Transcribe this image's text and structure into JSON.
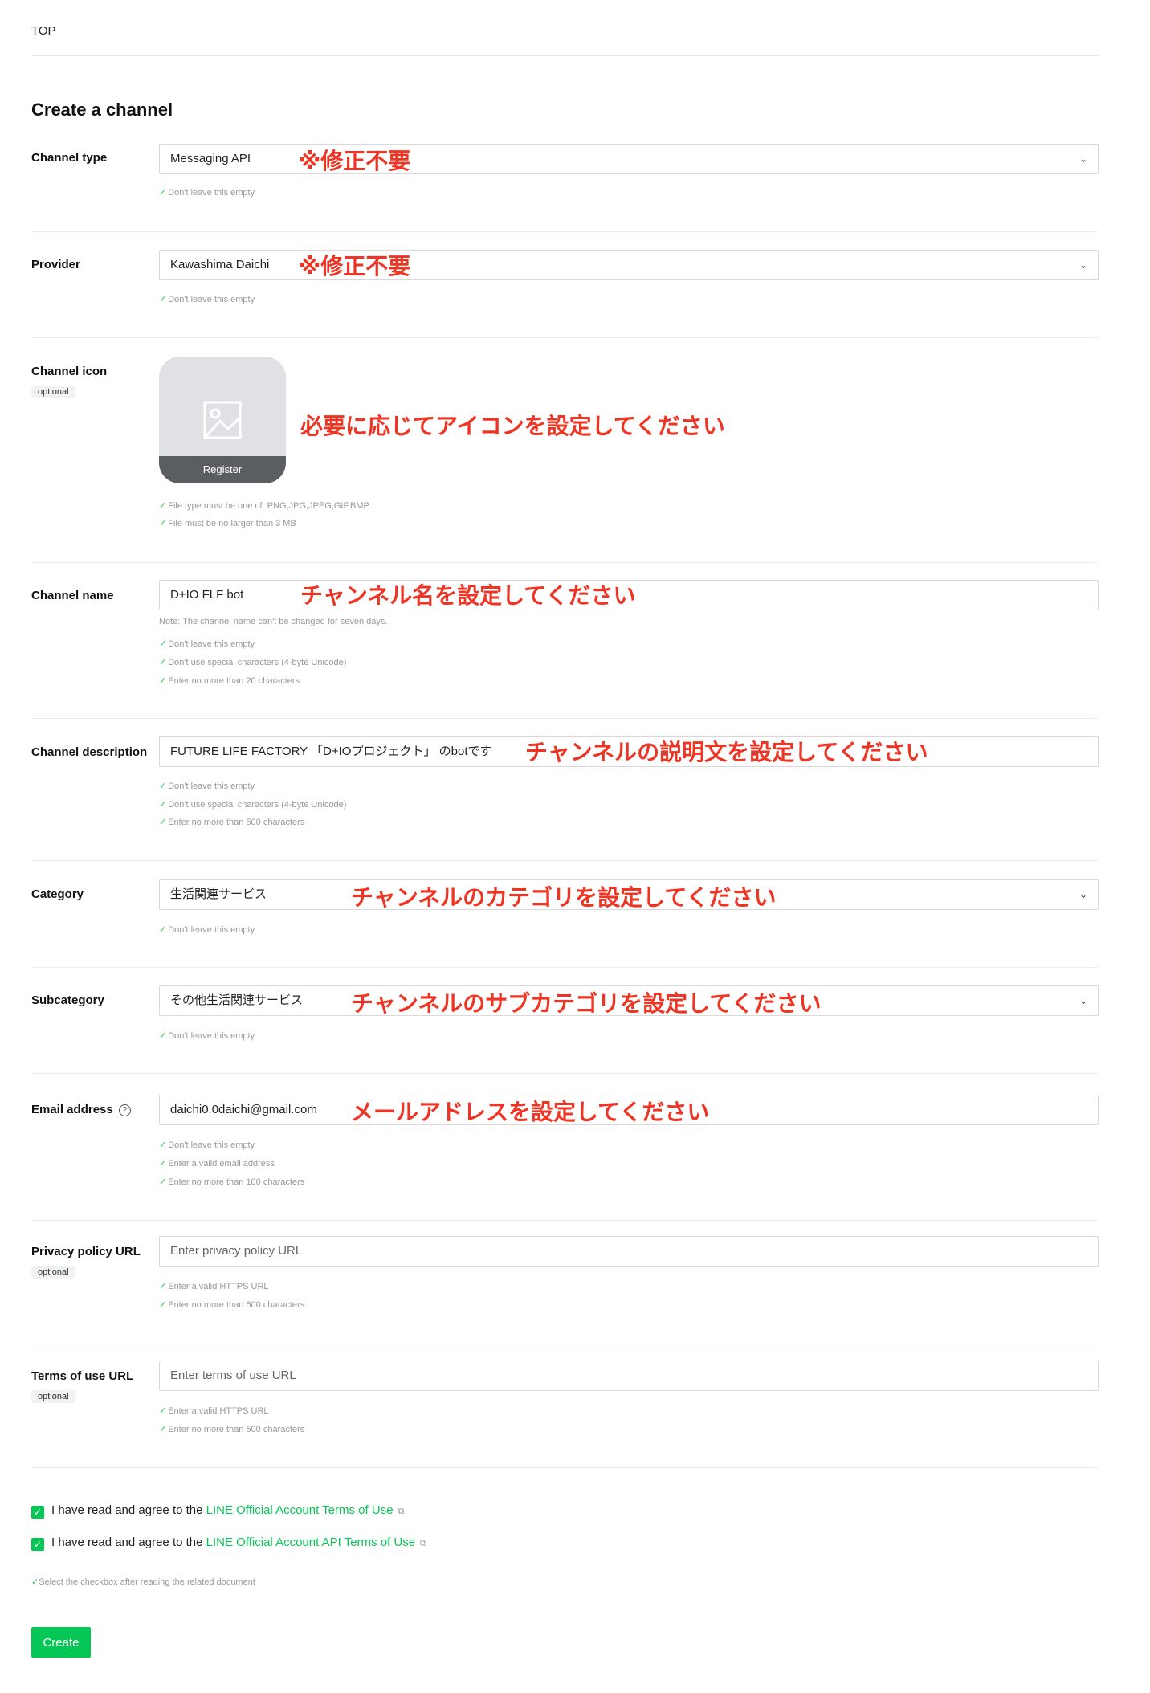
{
  "breadcrumb": "TOP",
  "page_title": "Create a channel",
  "optional_label": "optional",
  "channel_type": {
    "label": "Channel type",
    "value": "Messaging API",
    "annotation": "※修正不要",
    "hints": [
      "Don't leave this empty"
    ]
  },
  "provider": {
    "label": "Provider",
    "value": "Kawashima Daichi",
    "annotation": "※修正不要",
    "hints": [
      "Don't leave this empty"
    ]
  },
  "channel_icon": {
    "label": "Channel icon",
    "register_label": "Register",
    "annotation": "必要に応じてアイコンを設定してください",
    "hints": [
      "File type must be one of: PNG,JPG,JPEG,GIF,BMP",
      "File must be no larger than 3 MB"
    ]
  },
  "channel_name": {
    "label": "Channel name",
    "value": "D+IO FLF bot",
    "annotation": "チャンネル名を設定してください",
    "note": "Note: The channel name can't be changed for seven days.",
    "hints": [
      "Don't leave this empty",
      "Don't use special characters (4-byte Unicode)",
      "Enter no more than 20 characters"
    ]
  },
  "channel_description": {
    "label": "Channel description",
    "value": "FUTURE LIFE FACTORY 「D+IOプロジェクト」 のbotです",
    "annotation": "チャンネルの説明文を設定してください",
    "hints": [
      "Don't leave this empty",
      "Don't use special characters (4-byte Unicode)",
      "Enter no more than 500 characters"
    ]
  },
  "category": {
    "label": "Category",
    "value": "生活関連サービス",
    "annotation": "チャンネルのカテゴリを設定してください",
    "hints": [
      "Don't leave this empty"
    ]
  },
  "subcategory": {
    "label": "Subcategory",
    "value": "その他生活関連サービス",
    "annotation": "チャンネルのサブカテゴリを設定してください",
    "hints": [
      "Don't leave this empty"
    ]
  },
  "email": {
    "label": "Email address",
    "value": "daichi0.0daichi@gmail.com",
    "annotation": "メールアドレスを設定してください",
    "hints": [
      "Don't leave this empty",
      "Enter a valid email address",
      "Enter no more than 100 characters"
    ]
  },
  "privacy_policy": {
    "label": "Privacy policy URL",
    "placeholder": "Enter privacy policy URL",
    "hints": [
      "Enter a valid HTTPS URL",
      "Enter no more than 500 characters"
    ]
  },
  "terms_of_use": {
    "label": "Terms of use URL",
    "placeholder": "Enter terms of use URL",
    "hints": [
      "Enter a valid HTTPS URL",
      "Enter no more than 500 characters"
    ]
  },
  "agreements": {
    "prefix": "I have read and agree to the",
    "link1": "LINE Official Account Terms of Use",
    "link2": "LINE Official Account API Terms of Use",
    "hint": "Select the checkbox after reading the related document"
  },
  "create_label": "Create",
  "colors": {
    "brand_green": "#06c755",
    "annotation_red": "#ee3524"
  },
  "icons": {
    "check": "check-icon",
    "chevron": "chevron-down-icon",
    "help": "help-circle-icon",
    "external": "external-link-icon",
    "image": "image-placeholder-icon"
  }
}
